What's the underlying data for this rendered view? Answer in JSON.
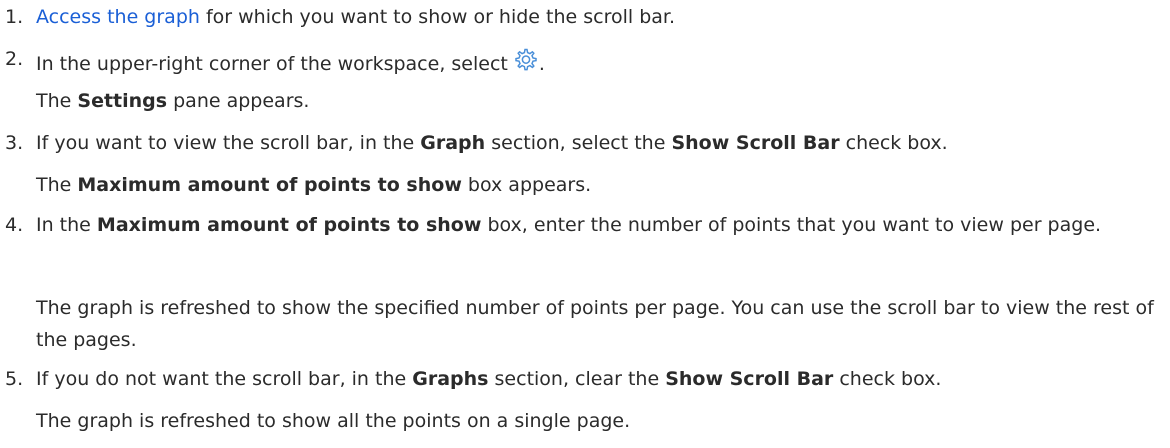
{
  "steps": [
    {
      "number": "1.",
      "link_text": "Access the graph",
      "rest": "for which you want to show or hide the scroll bar."
    },
    {
      "number": "2.",
      "before_icon": "In the upper-right corner of the workspace, select",
      "icon": "gear-icon",
      "after_icon": ".",
      "result_pre": "The",
      "result_bold": "Settings",
      "result_post": "pane appears."
    },
    {
      "number": "3.",
      "t1": "If you want to view the scroll bar, in the",
      "b1": "Graph",
      "t2": "section, select the",
      "b2": "Show Scroll Bar",
      "t3": "check box.",
      "result_pre": "The",
      "result_bold": "Maximum amount of points to show",
      "result_post": "box appears."
    },
    {
      "number": "4.",
      "t1": "In the",
      "b1": "Maximum amount of points to show",
      "t2": "box, enter the number of points that you want to view per page.",
      "result": "The graph is refreshed to show the specified number of points per page. You can use the scroll bar to view the rest of the pages."
    },
    {
      "number": "5.",
      "t1": "If you do not want the scroll bar, in the",
      "b1": "Graphs",
      "t2": "section, clear the",
      "b2": "Show Scroll Bar",
      "t3": "check box.",
      "result": "The graph is refreshed to show all the points on a single page."
    }
  ],
  "colors": {
    "link": "#1a5fd6",
    "text": "#2b2b2b",
    "icon": "#4a8fd8"
  }
}
